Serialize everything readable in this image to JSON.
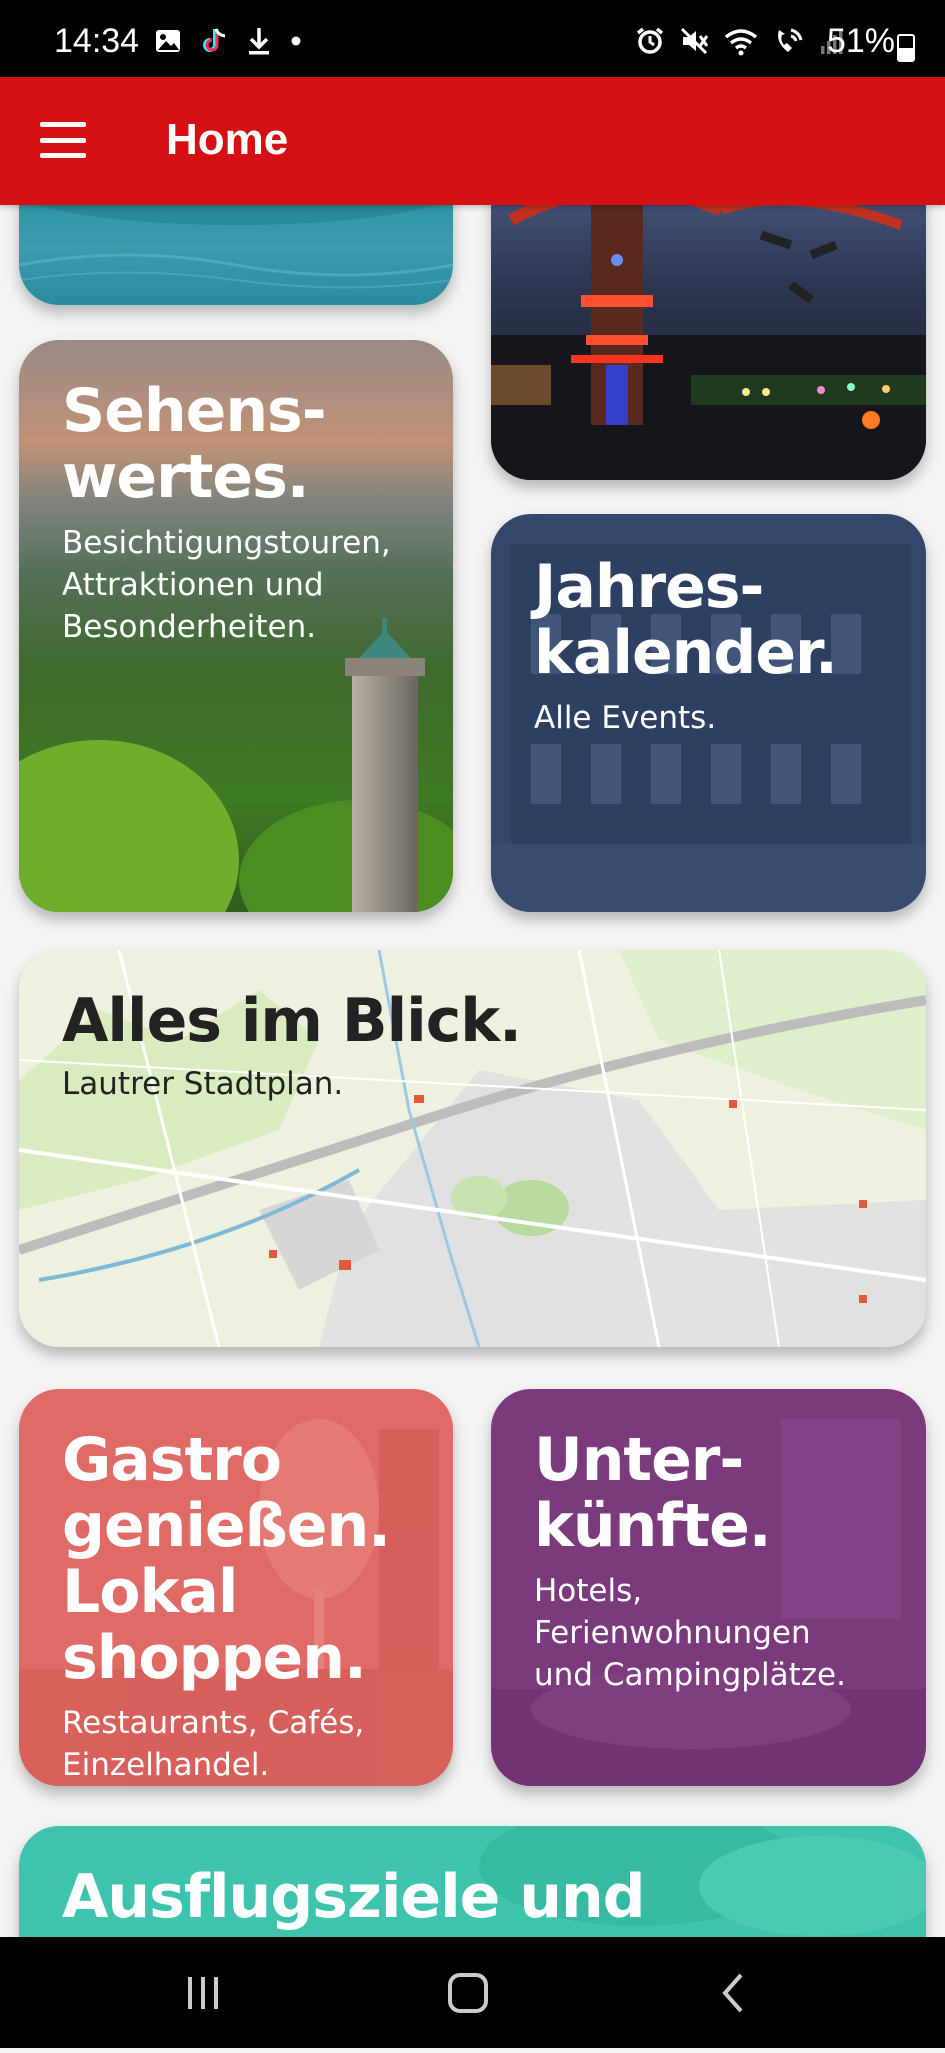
{
  "status_bar": {
    "time": "14:34",
    "battery": "51%",
    "icons": [
      "gallery-icon",
      "tiktok-icon",
      "download-icon",
      "dot-icon",
      "alarm-icon",
      "mute-icon",
      "wifi-icon",
      "wifi-calling-icon",
      "signal-icon",
      "battery-icon"
    ]
  },
  "app_bar": {
    "title": "Home",
    "menu_icon": "hamburger-menu-icon",
    "color": "#d41014"
  },
  "tiles": {
    "sights": {
      "title_line1": "Sehens-",
      "title_line2": "wertes.",
      "subtitle_line1": "Besichtigungstouren,",
      "subtitle_line2": "Attraktionen und",
      "subtitle_line3": "Besonderheiten."
    },
    "calendar": {
      "title_line1": "Jahres-",
      "title_line2": "kalender.",
      "subtitle": "Alle Events.",
      "color": "#34476b"
    },
    "map": {
      "title": "Alles im Blick.",
      "subtitle": "Lautrer Stadtplan."
    },
    "gastro": {
      "title_line1": "Gastro",
      "title_line2": "genießen.",
      "title_line3": "Lokal",
      "title_line4": "shoppen.",
      "subtitle_line1": "Restaurants, Cafés,",
      "subtitle_line2": "Einzelhandel.",
      "color": "#e06a65"
    },
    "stays": {
      "title_line1": "Unter-",
      "title_line2": "künfte.",
      "subtitle_line1": "Hotels,",
      "subtitle_line2": "Ferienwohnungen",
      "subtitle_line3": "und Campingplätze.",
      "color": "#7a3a7b"
    },
    "trips": {
      "title": "Ausflugsziele und",
      "color": "#3ec4ad"
    }
  },
  "nav_bar": {
    "buttons": [
      "recent-apps-icon",
      "home-icon",
      "back-icon"
    ]
  }
}
